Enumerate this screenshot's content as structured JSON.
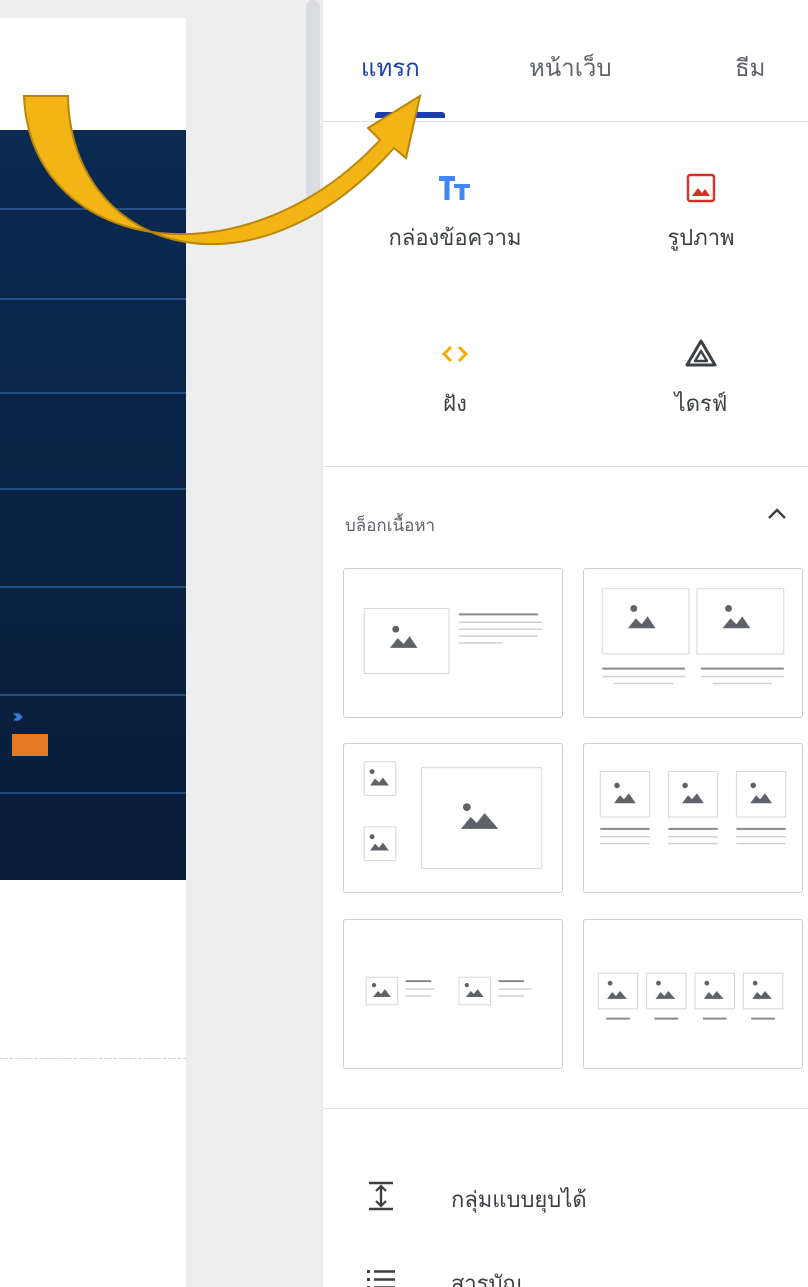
{
  "tabs": [
    {
      "label": "แทรก",
      "active": true
    },
    {
      "label": "หน้าเว็บ",
      "active": false
    },
    {
      "label": "ธีม",
      "active": false
    }
  ],
  "insert_tools": [
    {
      "label": "กล่องข้อความ",
      "icon": "text-box-icon"
    },
    {
      "label": "รูปภาพ",
      "icon": "image-icon"
    },
    {
      "label": "ฝัง",
      "icon": "embed-icon"
    },
    {
      "label": "ไดรฟ์",
      "icon": "drive-icon"
    }
  ],
  "content_blocks": {
    "title": "บล็อกเนื้อหา",
    "layouts": [
      "image-with-text",
      "two-images-with-text",
      "image-collage",
      "three-images-with-text",
      "two-image-text-pairs",
      "four-images-with-text"
    ]
  },
  "list_items": [
    {
      "label": "กลุ่มแบบยุบได้",
      "icon": "collapsible-group-icon"
    },
    {
      "label": "สารบัญ",
      "icon": "table-of-contents-icon"
    }
  ],
  "colors": {
    "accent": "#1a3fa8",
    "banner": "#0a2447",
    "arrow": "#f3b416",
    "image_icon": "#d93025",
    "embed_icon": "#f9ab00",
    "text_icon": "#4285f4"
  }
}
